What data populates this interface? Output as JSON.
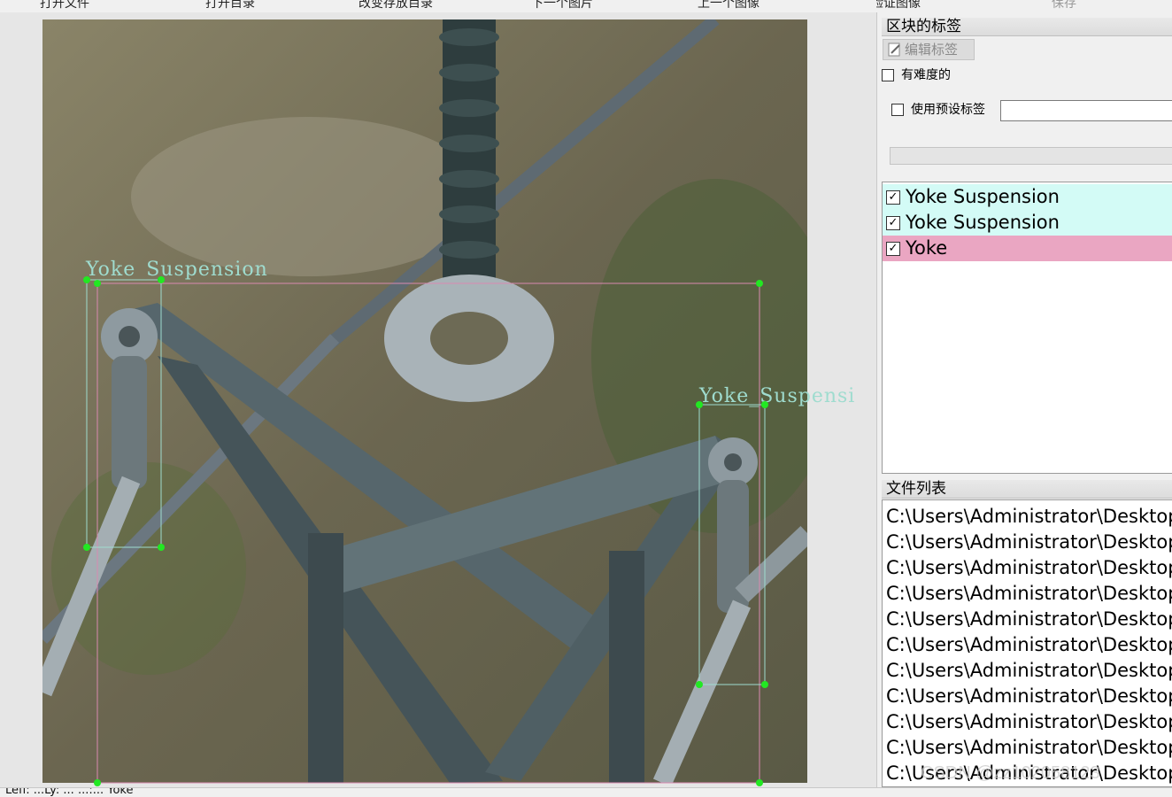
{
  "toolbar": {
    "items": [
      {
        "label": "打开文件",
        "enabled": true
      },
      {
        "label": "打开目录",
        "enabled": true
      },
      {
        "label": "改变存放目录",
        "enabled": true
      },
      {
        "label": "下一个图片",
        "enabled": true
      },
      {
        "label": "上一个图像",
        "enabled": true
      },
      {
        "label": "验证图像",
        "enabled": true
      },
      {
        "label": "保存",
        "enabled": false
      }
    ]
  },
  "canvas": {
    "boxes": [
      {
        "label": "Yoke_Suspension",
        "color": "#9fdccf"
      },
      {
        "label": "Yoke_Suspensi",
        "color": "#9fdccf"
      },
      {
        "label": "Yoke",
        "color": "#d98ab0"
      }
    ]
  },
  "labels_panel": {
    "title": "区块的标签",
    "edit_button": "编辑标签",
    "difficult_checkbox": {
      "label": "有难度的",
      "checked": false
    },
    "preset_checkbox": {
      "label": "使用预设标签",
      "checked": false
    },
    "preset_input_value": "",
    "items": [
      {
        "text": "Yoke Suspension",
        "checked": true,
        "color": "#d3fbf6"
      },
      {
        "text": "Yoke Suspension",
        "checked": true,
        "color": "#d3fbf6"
      },
      {
        "text": "Yoke",
        "checked": true,
        "color": "#eaa6c2"
      }
    ]
  },
  "files_panel": {
    "title": "文件列表",
    "items": [
      "C:\\Users\\Administrator\\Desktop\\d",
      "C:\\Users\\Administrator\\Desktop\\d",
      "C:\\Users\\Administrator\\Desktop\\d",
      "C:\\Users\\Administrator\\Desktop\\d",
      "C:\\Users\\Administrator\\Desktop\\d",
      "C:\\Users\\Administrator\\Desktop\\d",
      "C:\\Users\\Administrator\\Desktop\\d",
      "C:\\Users\\Administrator\\Desktop\\d",
      "C:\\Users\\Administrator\\Desktop\\d",
      "C:\\Users\\Administrator\\Desktop\\d",
      "C:\\Users\\Administrator\\Desktop\\d"
    ]
  },
  "status": {
    "text": "Lefl: ...Ly: ... ...:... Yoke"
  },
  "watermark": "CSDN @zz102058123"
}
